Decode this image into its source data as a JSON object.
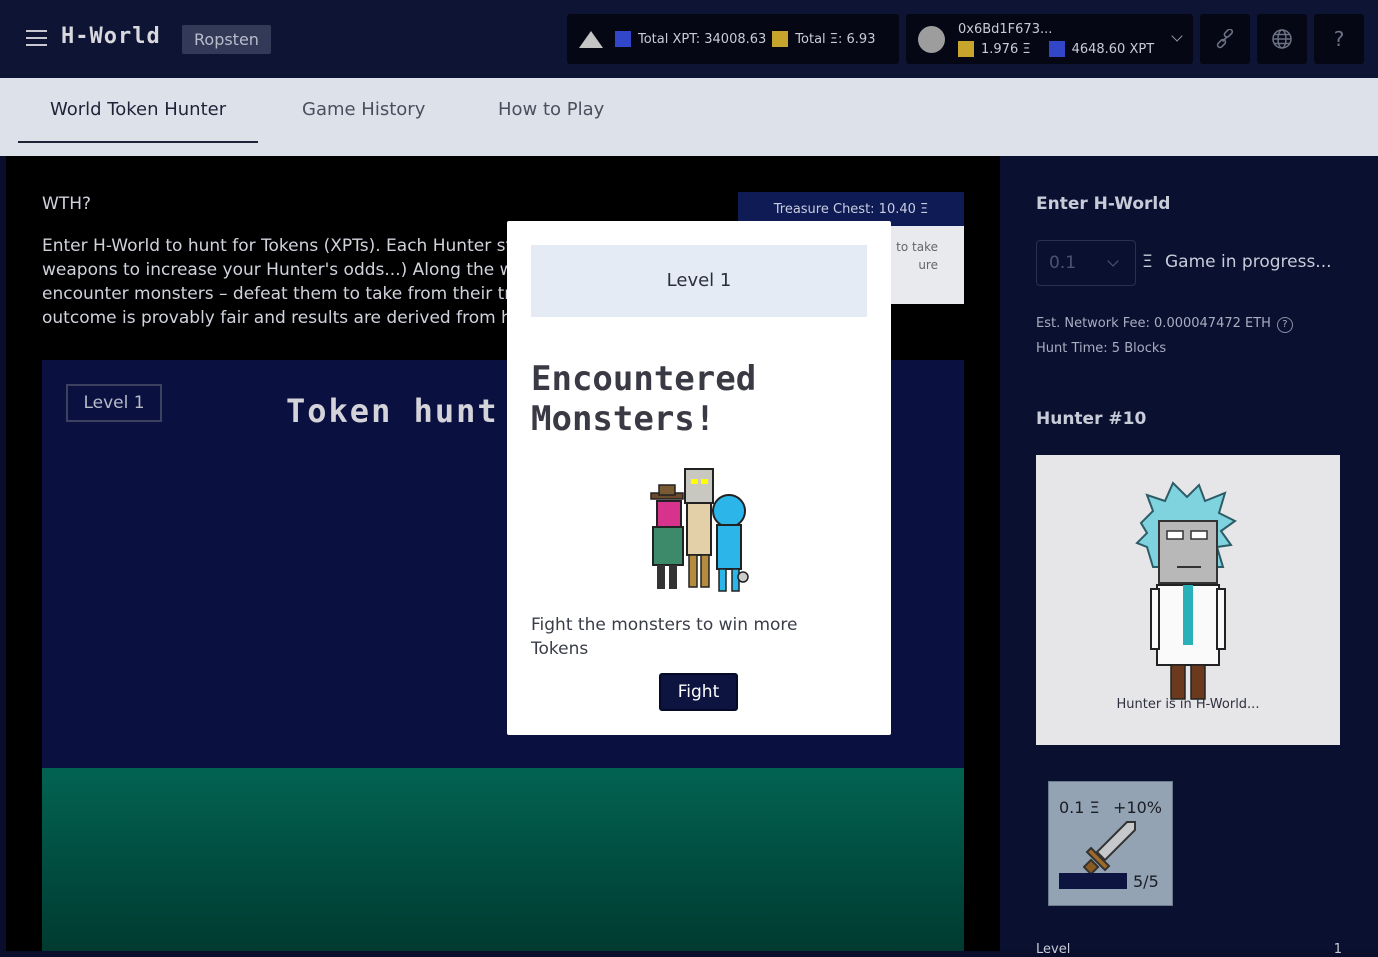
{
  "header": {
    "brand": "H-World",
    "network": "Ropsten",
    "total_xpt": "Total XPT: 34008.63",
    "total_eth": "Total Ξ: 6.93",
    "wallet_address": "0x6Bd1F673...",
    "wallet_eth": "1.976 Ξ",
    "wallet_xpt": "4648.60 XPT",
    "icons": [
      "menu-icon",
      "mountain-icon",
      "link-icon",
      "globe-icon",
      "help-icon"
    ]
  },
  "tabs": [
    {
      "label": "World Token Hunter",
      "active": true
    },
    {
      "label": "Game History",
      "active": false
    },
    {
      "label": "How to Play",
      "active": false
    }
  ],
  "main": {
    "heading": "WTH?",
    "description": "Enter H-World to hunt for Tokens (XPTs). Each Hunter starts at 50%. (Increase weapons to increase your Hunter's odds...) Along the way your Hunter will encounter monsters – defeat them to take from their treasure chest! Each hunt's outcome is provably fair and results are derived from hashes of the blocks mined.",
    "treasure_chest": "Treasure Chest: 10.40 Ξ",
    "treasure_text_1": "to take",
    "treasure_text_2": "ure",
    "level_pill": "Level 1",
    "hunt_title": "Token hunt"
  },
  "modal": {
    "level": "Level 1",
    "title": "Encountered Monsters!",
    "text": "Fight the monsters to win more Tokens",
    "button": "Fight"
  },
  "side": {
    "enter_heading": "Enter H-World",
    "amount": "0.1",
    "eth_symbol": "Ξ",
    "status": "Game in progress...",
    "fee": "Est. Network Fee: 0.000047472 ETH",
    "hunt_time": "Hunt Time: 5 Blocks",
    "hunter_heading": "Hunter #10",
    "hunter_status": "Hunter is in H-World...",
    "weapon_cost": "0.1 Ξ",
    "weapon_bonus": "+10%",
    "weapon_count": "5/5",
    "bottom_label": "Level",
    "bottom_value": "1"
  },
  "colors": {
    "header_bg": "#0e1433",
    "accent_navy": "#0d1440",
    "xpt_chip": "#3246c8",
    "eth_chip": "#c7a52d",
    "ground": "#026352"
  }
}
